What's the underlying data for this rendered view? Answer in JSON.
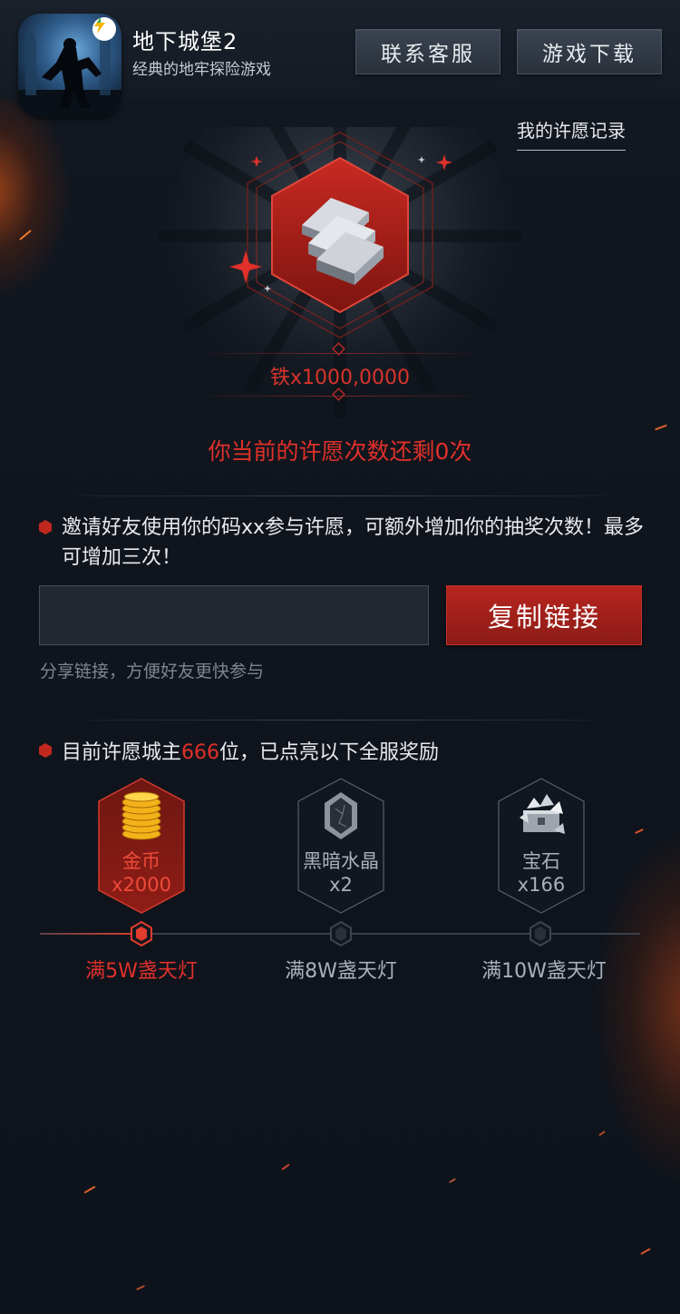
{
  "app": {
    "name": "地下城堡2",
    "description": "经典的地牢探险游戏",
    "icon": "dungeon-hero-app-icon",
    "badge_icon": "lightning-bolt-icon"
  },
  "header": {
    "service_label": "联系客服",
    "download_label": "游戏下载"
  },
  "records_link": "我的许愿记录",
  "prize": {
    "icon": "iron-ingots-icon",
    "name": "铁x1000,0000"
  },
  "remaining_text": "你当前的许愿次数还剩0次",
  "invite": {
    "text": "邀请好友使用你的码xx参与许愿，可额外增加你的抽奖次数！最多可增加三次！",
    "code_value": "",
    "copy_label": "复制链接",
    "hint": "分享链接，方便好友更快参与"
  },
  "lords": {
    "prefix": "目前许愿城主",
    "count": "666",
    "suffix": "位，已点亮以下全服奖励"
  },
  "rewards": [
    {
      "name": "金币",
      "amount": "x2000",
      "icon": "gold-coins-icon",
      "milestone": "满5W盏天灯",
      "unlocked": true
    },
    {
      "name": "黑暗水晶",
      "amount": "x2",
      "icon": "dark-crystal-icon",
      "milestone": "满8W盏天灯",
      "unlocked": false
    },
    {
      "name": "宝石",
      "amount": "x166",
      "icon": "gems-chest-icon",
      "milestone": "满10W盏天灯",
      "unlocked": false
    }
  ],
  "progress": {
    "unlocked_milestones": 1,
    "total_milestones": 3
  },
  "colors": {
    "accent_red": "#e0302a",
    "background": "#111720",
    "muted_text": "#a9b0b9"
  }
}
